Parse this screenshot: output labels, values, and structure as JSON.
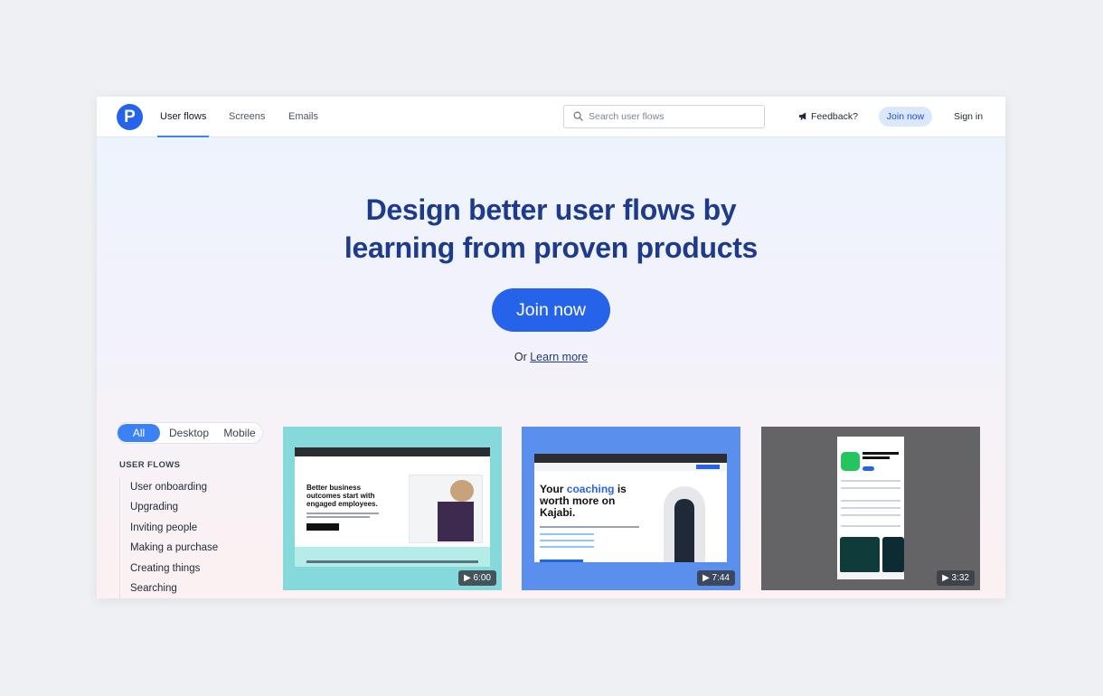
{
  "nav": {
    "logo_letter": "P",
    "tabs": [
      {
        "label": "User flows",
        "active": true
      },
      {
        "label": "Screens",
        "active": false
      },
      {
        "label": "Emails",
        "active": false
      }
    ],
    "search_placeholder": "Search user flows",
    "feedback_label": "Feedback?",
    "join_label": "Join now",
    "signin_label": "Sign in"
  },
  "hero": {
    "headline_line1": "Design better user flows by",
    "headline_line2": "learning from proven products",
    "cta_label": "Join now",
    "or_text": "Or",
    "learn_more_label": "Learn more"
  },
  "filters": {
    "options": [
      "All",
      "Desktop",
      "Mobile"
    ],
    "selected": "All"
  },
  "sidebar": {
    "heading": "USER FLOWS",
    "items": [
      "User onboarding",
      "Upgrading",
      "Inviting people",
      "Making a purchase",
      "Creating things",
      "Searching"
    ]
  },
  "cards": [
    {
      "duration": "6:00",
      "color": "#86d9db",
      "preview_headline": "Better business outcomes start with engaged employees."
    },
    {
      "duration": "7:44",
      "color": "#5b8fee",
      "preview_headline_prefix": "Your",
      "preview_headline_highlight": "coaching",
      "preview_headline_suffix": "is worth more on Kajabi."
    },
    {
      "duration": "3:32",
      "color": "#646467"
    }
  ],
  "colors": {
    "brand": "#2563eb",
    "headline": "#1e3a8a",
    "active_tab_underline": "#3b82f6"
  }
}
